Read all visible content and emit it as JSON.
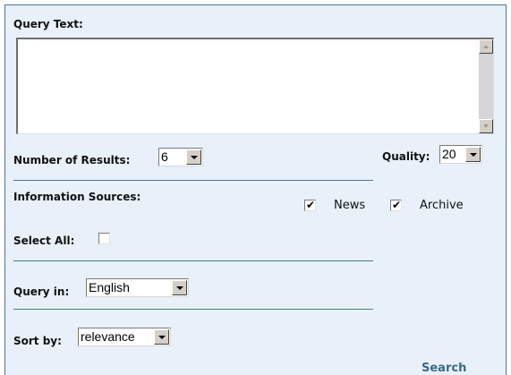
{
  "form": {
    "query_text_label": "Query Text:",
    "query_text_value": "",
    "results_label": "Number of Results:",
    "results_value": "6",
    "quality_label": "Quality:",
    "quality_value": "20",
    "sources_label": "Information Sources:",
    "sources": [
      {
        "label": "News",
        "checked": true
      },
      {
        "label": "Archive",
        "checked": true
      }
    ],
    "select_all_label": "Select All:",
    "select_all_checked": false,
    "query_in_label": "Query in:",
    "query_in_value": "English",
    "sort_by_label": "Sort by:",
    "sort_by_value": "relevance",
    "search_label": "Search"
  },
  "colors": {
    "panel_bg": "#e8f1f9",
    "panel_border": "#4e7495",
    "divider": "#4e7495",
    "search_link": "#3c6888"
  }
}
